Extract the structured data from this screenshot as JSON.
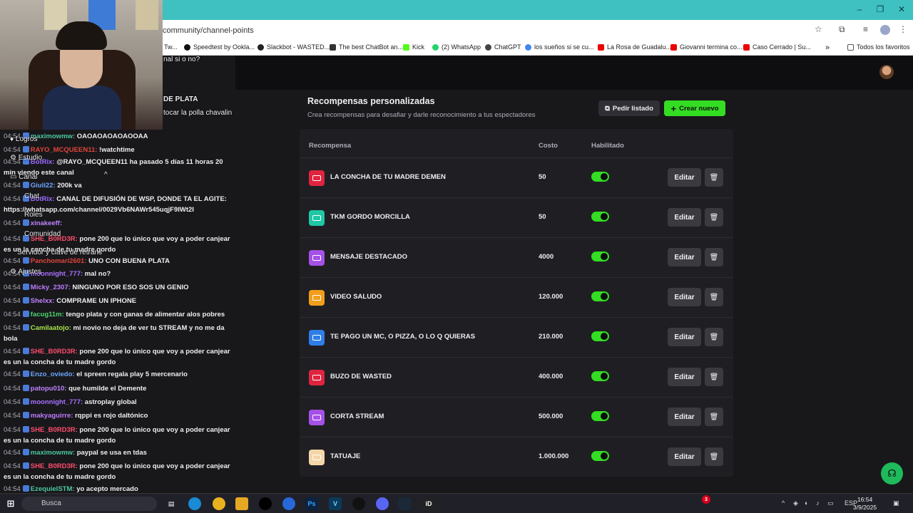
{
  "browser": {
    "url": "community/channel-points",
    "bookmarks": [
      "Tw...",
      "Speedtest by Ookla...",
      "Slackbot - WASTED...",
      "The best ChatBot an...",
      "Kick",
      "(2) WhatsApp",
      "ChatGPT",
      "los sueños si se cu...",
      "La Rosa de Guadalu...",
      "Giovanni termina co...",
      "Caso Cerrado | Su...",
      "Todos los favoritos"
    ],
    "win_min": "–",
    "win_max": "❐",
    "win_close": "✕",
    "more_bookmarks": "»"
  },
  "overlay_menu": {
    "items": [
      "Logros",
      "Estudio",
      "Canal",
      "Chat",
      "Roles",
      "Comunidad",
      "Servidor y clave de retrans",
      "Ajustes"
    ],
    "top_snippets": [
      "nal si o no?",
      "DE PLATA",
      "tocar la polla chavalin"
    ]
  },
  "chat": [
    {
      "time": "04:54",
      "user": "maximowmw:",
      "user_color": "#4cc7a0",
      "msg": "OAOAOAOAOAOOAA"
    },
    {
      "time": "04:54",
      "user": "RAYO_MCQUEEN11:",
      "user_color": "#e0443a",
      "msg": "!watchtime"
    },
    {
      "time": "04:54",
      "user": "BotRix:",
      "user_color": "#9c6bff",
      "msg": "@RAYO_MCQUEEN11 ha pasado 5 días 11 horas 20 min viendo este canal"
    },
    {
      "time": "04:54",
      "user": "Giuli22:",
      "user_color": "#6ea6ff",
      "msg": "200k va"
    },
    {
      "time": "04:54",
      "user": "BotRix:",
      "user_color": "#9c6bff",
      "msg": "CANAL DE DIFUSIÓN DE WSP, DONDE TA EL AGITE: https://whatsapp.com/channel/0029Vb6NAWr545uqjF9IWt2I"
    },
    {
      "time": "04:54",
      "user": "xinakeeff:",
      "user_color": "#c183ff",
      "msg": ""
    },
    {
      "time": "04:54",
      "user": "SHE_B0RD3R:",
      "user_color": "#ff4d6d",
      "msg": "pone 200 que lo único que voy a poder canjear es un la concha de tu madre gordo"
    },
    {
      "time": "04:54",
      "user": "Panchomari2601:",
      "user_color": "#e0443a",
      "msg": "UNO CON BUENA PLATA"
    },
    {
      "time": "04:54",
      "user": "moonnight_777:",
      "user_color": "#a970ff",
      "msg": "mal no?"
    },
    {
      "time": "04:54",
      "user": "Micky_2307:",
      "user_color": "#bf7bff",
      "msg": "NINGUNO POR ESO SOS UN GENIO"
    },
    {
      "time": "04:54",
      "user": "Shelxx:",
      "user_color": "#c183ff",
      "msg": "COMPRAME UN IPHONE"
    },
    {
      "time": "04:54",
      "user": "facug11m:",
      "user_color": "#4cd46a",
      "msg": "tengo plata y con ganas de alimentar alos pobres"
    },
    {
      "time": "04:54",
      "user": "Camilaatojo:",
      "user_color": "#a6e34a",
      "msg": "mi novio no deja de ver tu STREAM y no me da bola"
    },
    {
      "time": "04:54",
      "user": "SHE_B0RD3R:",
      "user_color": "#ff4d6d",
      "msg": "pone 200 que lo único que voy a poder canjear es un la concha de tu madre gordo"
    },
    {
      "time": "04:54",
      "user": "Enzo_oviedo:",
      "user_color": "#6ea6ff",
      "msg": "el spreen regala play 5 mercenario"
    },
    {
      "time": "04:54",
      "user": "patopu010:",
      "user_color": "#c183ff",
      "msg": "que humilde el Demente"
    },
    {
      "time": "04:54",
      "user": "moonnight_777:",
      "user_color": "#a970ff",
      "msg": "astroplay global"
    },
    {
      "time": "04:54",
      "user": "makyaguirre:",
      "user_color": "#bf7bff",
      "msg": "rqppi es rojo daltónico"
    },
    {
      "time": "04:54",
      "user": "SHE_B0RD3R:",
      "user_color": "#ff4d6d",
      "msg": "pone 200 que lo único que voy a poder canjear es un la concha de tu madre gordo"
    },
    {
      "time": "04:54",
      "user": "maximowmw:",
      "user_color": "#4cc7a0",
      "msg": "paypal se usa en tdas"
    },
    {
      "time": "04:54",
      "user": "SHE_B0RD3R:",
      "user_color": "#ff4d6d",
      "msg": "pone 200 que lo único que voy a poder canjear es un la concha de tu madre gordo"
    },
    {
      "time": "04:54",
      "user": "EzequielSTM:",
      "user_color": "#4cc7a0",
      "msg": "yo acepto mercado"
    }
  ],
  "rewards": {
    "title": "Recompensas personalizadas",
    "subtitle": "Crea recompensas para desafiar y darle reconocimiento a tus espectadores",
    "btn_list": "Pedir listado",
    "btn_new": "Crear nuevo",
    "columns": {
      "reward": "Recompensa",
      "cost": "Costo",
      "enabled": "Habilitado"
    },
    "edit_label": "Editar",
    "items": [
      {
        "name": "LA CONCHA DE TU MADRE DEMEN",
        "cost": "50",
        "color": "#e0243e",
        "enabled": true
      },
      {
        "name": "TKM GORDO MORCILLA",
        "cost": "50",
        "color": "#1fc7a5",
        "enabled": true
      },
      {
        "name": "MENSAJE DESTACADO",
        "cost": "4000",
        "color": "#a551e8",
        "enabled": true
      },
      {
        "name": "VIDEO SALUDO",
        "cost": "120.000",
        "color": "#f29e1a",
        "enabled": true
      },
      {
        "name": "TE PAGO UN MC, O PIZZA, O LO Q QUIERAS",
        "cost": "210.000",
        "color": "#2f7ee8",
        "enabled": true
      },
      {
        "name": "BUZO DE WASTED",
        "cost": "400.000",
        "color": "#e0243e",
        "enabled": true
      },
      {
        "name": "CORTA STREAM",
        "cost": "500.000",
        "color": "#a551e8",
        "enabled": true
      },
      {
        "name": "TATUAJE",
        "cost": "1.000.000",
        "color": "#f3d6a8",
        "enabled": true
      }
    ]
  },
  "taskbar": {
    "search": "Busca",
    "lang": "ESP",
    "time": "16:54",
    "date": "3/9/2025",
    "notif_count": "3"
  },
  "colors": {
    "accent_green": "#33dd22",
    "help_green": "#1fba5b",
    "titlebar": "#3fc1c2"
  }
}
